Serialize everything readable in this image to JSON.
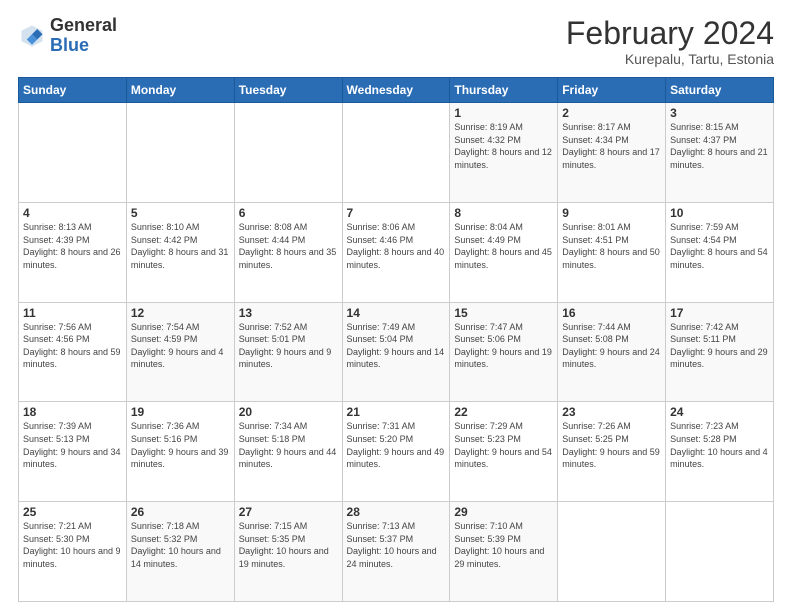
{
  "header": {
    "logo_general": "General",
    "logo_blue": "Blue",
    "title": "February 2024",
    "subtitle": "Kurepalu, Tartu, Estonia"
  },
  "calendar": {
    "days_of_week": [
      "Sunday",
      "Monday",
      "Tuesday",
      "Wednesday",
      "Thursday",
      "Friday",
      "Saturday"
    ],
    "weeks": [
      [
        {
          "day": "",
          "sunrise": "",
          "sunset": "",
          "daylight": ""
        },
        {
          "day": "",
          "sunrise": "",
          "sunset": "",
          "daylight": ""
        },
        {
          "day": "",
          "sunrise": "",
          "sunset": "",
          "daylight": ""
        },
        {
          "day": "",
          "sunrise": "",
          "sunset": "",
          "daylight": ""
        },
        {
          "day": "1",
          "sunrise": "Sunrise: 8:19 AM",
          "sunset": "Sunset: 4:32 PM",
          "daylight": "Daylight: 8 hours and 12 minutes."
        },
        {
          "day": "2",
          "sunrise": "Sunrise: 8:17 AM",
          "sunset": "Sunset: 4:34 PM",
          "daylight": "Daylight: 8 hours and 17 minutes."
        },
        {
          "day": "3",
          "sunrise": "Sunrise: 8:15 AM",
          "sunset": "Sunset: 4:37 PM",
          "daylight": "Daylight: 8 hours and 21 minutes."
        }
      ],
      [
        {
          "day": "4",
          "sunrise": "Sunrise: 8:13 AM",
          "sunset": "Sunset: 4:39 PM",
          "daylight": "Daylight: 8 hours and 26 minutes."
        },
        {
          "day": "5",
          "sunrise": "Sunrise: 8:10 AM",
          "sunset": "Sunset: 4:42 PM",
          "daylight": "Daylight: 8 hours and 31 minutes."
        },
        {
          "day": "6",
          "sunrise": "Sunrise: 8:08 AM",
          "sunset": "Sunset: 4:44 PM",
          "daylight": "Daylight: 8 hours and 35 minutes."
        },
        {
          "day": "7",
          "sunrise": "Sunrise: 8:06 AM",
          "sunset": "Sunset: 4:46 PM",
          "daylight": "Daylight: 8 hours and 40 minutes."
        },
        {
          "day": "8",
          "sunrise": "Sunrise: 8:04 AM",
          "sunset": "Sunset: 4:49 PM",
          "daylight": "Daylight: 8 hours and 45 minutes."
        },
        {
          "day": "9",
          "sunrise": "Sunrise: 8:01 AM",
          "sunset": "Sunset: 4:51 PM",
          "daylight": "Daylight: 8 hours and 50 minutes."
        },
        {
          "day": "10",
          "sunrise": "Sunrise: 7:59 AM",
          "sunset": "Sunset: 4:54 PM",
          "daylight": "Daylight: 8 hours and 54 minutes."
        }
      ],
      [
        {
          "day": "11",
          "sunrise": "Sunrise: 7:56 AM",
          "sunset": "Sunset: 4:56 PM",
          "daylight": "Daylight: 8 hours and 59 minutes."
        },
        {
          "day": "12",
          "sunrise": "Sunrise: 7:54 AM",
          "sunset": "Sunset: 4:59 PM",
          "daylight": "Daylight: 9 hours and 4 minutes."
        },
        {
          "day": "13",
          "sunrise": "Sunrise: 7:52 AM",
          "sunset": "Sunset: 5:01 PM",
          "daylight": "Daylight: 9 hours and 9 minutes."
        },
        {
          "day": "14",
          "sunrise": "Sunrise: 7:49 AM",
          "sunset": "Sunset: 5:04 PM",
          "daylight": "Daylight: 9 hours and 14 minutes."
        },
        {
          "day": "15",
          "sunrise": "Sunrise: 7:47 AM",
          "sunset": "Sunset: 5:06 PM",
          "daylight": "Daylight: 9 hours and 19 minutes."
        },
        {
          "day": "16",
          "sunrise": "Sunrise: 7:44 AM",
          "sunset": "Sunset: 5:08 PM",
          "daylight": "Daylight: 9 hours and 24 minutes."
        },
        {
          "day": "17",
          "sunrise": "Sunrise: 7:42 AM",
          "sunset": "Sunset: 5:11 PM",
          "daylight": "Daylight: 9 hours and 29 minutes."
        }
      ],
      [
        {
          "day": "18",
          "sunrise": "Sunrise: 7:39 AM",
          "sunset": "Sunset: 5:13 PM",
          "daylight": "Daylight: 9 hours and 34 minutes."
        },
        {
          "day": "19",
          "sunrise": "Sunrise: 7:36 AM",
          "sunset": "Sunset: 5:16 PM",
          "daylight": "Daylight: 9 hours and 39 minutes."
        },
        {
          "day": "20",
          "sunrise": "Sunrise: 7:34 AM",
          "sunset": "Sunset: 5:18 PM",
          "daylight": "Daylight: 9 hours and 44 minutes."
        },
        {
          "day": "21",
          "sunrise": "Sunrise: 7:31 AM",
          "sunset": "Sunset: 5:20 PM",
          "daylight": "Daylight: 9 hours and 49 minutes."
        },
        {
          "day": "22",
          "sunrise": "Sunrise: 7:29 AM",
          "sunset": "Sunset: 5:23 PM",
          "daylight": "Daylight: 9 hours and 54 minutes."
        },
        {
          "day": "23",
          "sunrise": "Sunrise: 7:26 AM",
          "sunset": "Sunset: 5:25 PM",
          "daylight": "Daylight: 9 hours and 59 minutes."
        },
        {
          "day": "24",
          "sunrise": "Sunrise: 7:23 AM",
          "sunset": "Sunset: 5:28 PM",
          "daylight": "Daylight: 10 hours and 4 minutes."
        }
      ],
      [
        {
          "day": "25",
          "sunrise": "Sunrise: 7:21 AM",
          "sunset": "Sunset: 5:30 PM",
          "daylight": "Daylight: 10 hours and 9 minutes."
        },
        {
          "day": "26",
          "sunrise": "Sunrise: 7:18 AM",
          "sunset": "Sunset: 5:32 PM",
          "daylight": "Daylight: 10 hours and 14 minutes."
        },
        {
          "day": "27",
          "sunrise": "Sunrise: 7:15 AM",
          "sunset": "Sunset: 5:35 PM",
          "daylight": "Daylight: 10 hours and 19 minutes."
        },
        {
          "day": "28",
          "sunrise": "Sunrise: 7:13 AM",
          "sunset": "Sunset: 5:37 PM",
          "daylight": "Daylight: 10 hours and 24 minutes."
        },
        {
          "day": "29",
          "sunrise": "Sunrise: 7:10 AM",
          "sunset": "Sunset: 5:39 PM",
          "daylight": "Daylight: 10 hours and 29 minutes."
        },
        {
          "day": "",
          "sunrise": "",
          "sunset": "",
          "daylight": ""
        },
        {
          "day": "",
          "sunrise": "",
          "sunset": "",
          "daylight": ""
        }
      ]
    ]
  }
}
